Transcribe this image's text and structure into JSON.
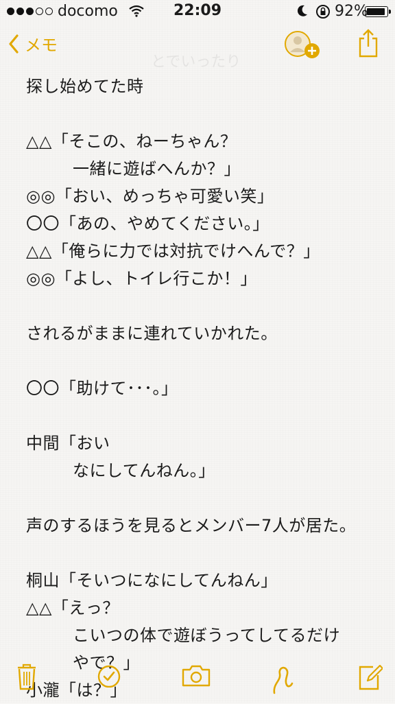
{
  "status_bar": {
    "carrier": "docomo",
    "time": "22:09",
    "battery_percent": "92%",
    "signal_bars_filled": 3,
    "signal_bars_total": 5
  },
  "nav": {
    "back_label": "メモ"
  },
  "ghost_text": "とでいったり",
  "note_lines": [
    {
      "text": "探し始めてた時",
      "indent": false
    },
    {
      "text": "",
      "indent": false
    },
    {
      "text": "△△「そこの、ねーちゃん？",
      "indent": false
    },
    {
      "text": "一緒に遊ばへんか？」",
      "indent": true
    },
    {
      "text": "◎◎「おい、めっちゃ可愛い笑」",
      "indent": false
    },
    {
      "text": "〇〇「あの、やめてください。」",
      "indent": false
    },
    {
      "text": "△△「俺らに力では対抗でけへんで？」",
      "indent": false
    },
    {
      "text": "◎◎「よし、トイレ行こか！」",
      "indent": false
    },
    {
      "text": "",
      "indent": false
    },
    {
      "text": "されるがままに連れていかれた。",
      "indent": false
    },
    {
      "text": "",
      "indent": false
    },
    {
      "text": "〇〇「助けて･･･。」",
      "indent": false
    },
    {
      "text": "",
      "indent": false
    },
    {
      "text": "中間「おい",
      "indent": false
    },
    {
      "text": "なにしてんねん。」",
      "indent": true
    },
    {
      "text": "",
      "indent": false
    },
    {
      "text": "声のするほうを見るとメンバー7人が居た。",
      "indent": false
    },
    {
      "text": "",
      "indent": false
    },
    {
      "text": "桐山「そいつになにしてんねん」",
      "indent": false
    },
    {
      "text": "△△「えっ？",
      "indent": false
    },
    {
      "text": "こいつの体で遊ぼうってしてるだけ",
      "indent": true
    },
    {
      "text": "やで？」",
      "indent": true
    },
    {
      "text": "小瀧「は？」",
      "indent": false
    }
  ],
  "colors": {
    "accent": "#e1a800",
    "background": "#f6f5f3",
    "text": "#1b1b1b"
  },
  "toolbar": {
    "icons": [
      "trash-icon",
      "checklist-icon",
      "camera-icon",
      "sketch-icon",
      "compose-icon"
    ]
  }
}
